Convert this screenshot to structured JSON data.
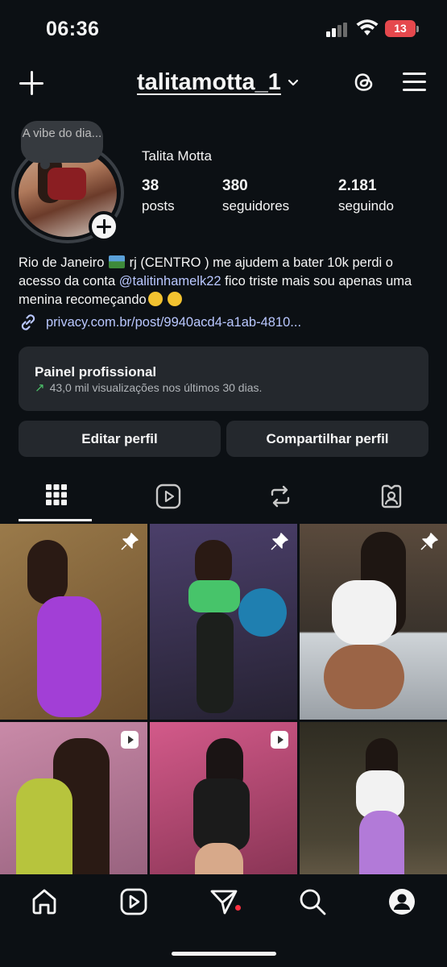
{
  "status_bar": {
    "time": "06:36",
    "battery": "13"
  },
  "header": {
    "username": "talitamotta_1"
  },
  "profile": {
    "note": "A vibe do dia...",
    "display_name": "Talita Motta",
    "stats": [
      {
        "value": "38",
        "label": "posts"
      },
      {
        "value": "380",
        "label": "seguidores"
      },
      {
        "value": "2.181",
        "label": "seguindo"
      }
    ],
    "bio": {
      "part1": "Rio de Janeiro",
      "part2": " rj (CENTRO ) me ajudem a bater 10k perdi o acesso da conta ",
      "mention": "@talitinhamelk22",
      "part3": "  fico triste mais sou apenas uma menina recomeçando"
    },
    "link": "privacy.com.br/post/9940acd4-a1ab-4810..."
  },
  "panel": {
    "title": "Painel profissional",
    "subtitle": "43,0 mil visualizações nos últimos 30 dias."
  },
  "buttons": {
    "edit": "Editar perfil",
    "share": "Compartilhar perfil"
  },
  "tabs": [
    "grid-icon",
    "reels-icon",
    "reposts-icon",
    "tagged-icon"
  ],
  "grid": [
    {
      "badge": "pin",
      "bg": "#8b6a3e",
      "accent": "#a23fd6"
    },
    {
      "badge": "pin",
      "bg": "#3b3550",
      "accent": "#47c46a"
    },
    {
      "badge": "pin",
      "bg": "#5b4a3a",
      "accent": "#f2f2f2"
    },
    {
      "badge": "reel",
      "bg": "#b56a8f",
      "accent": "#b7c43d"
    },
    {
      "badge": "reel",
      "bg": "#b84a76",
      "accent": "#1b1b1b"
    },
    {
      "badge": "",
      "bg": "#3d3a2c",
      "accent": "#b27ad8"
    }
  ],
  "bottom_nav": [
    "home-icon",
    "reels-icon",
    "messages-icon",
    "search-icon",
    "profile-icon"
  ],
  "colors": {
    "background": "#0c1014",
    "card": "#24282d",
    "link": "#b9c7ff",
    "battery": "#e5484d",
    "trend": "#4cc36a",
    "notification_dot": "#ff3040"
  }
}
